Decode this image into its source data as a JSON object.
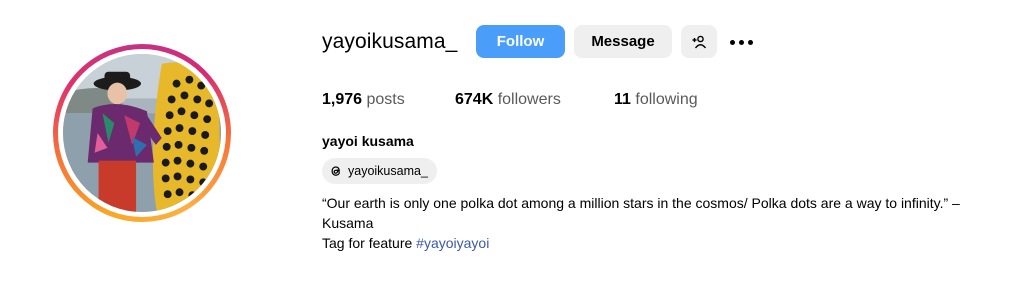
{
  "profile": {
    "username": "yayoikusama_",
    "full_name": "yayoi kusama",
    "threads_handle": "yayoikusama_",
    "avatar_alt": "yayoikusama_'s profile picture"
  },
  "actions": {
    "follow_label": "Follow",
    "message_label": "Message",
    "suggest_icon": "person-add-icon",
    "more_icon": "more-options-icon"
  },
  "stats": {
    "posts_count": "1,976",
    "posts_label": "posts",
    "followers_count": "674K",
    "followers_label": "followers",
    "following_count": "11",
    "following_label": "following"
  },
  "bio": {
    "quote_line": "“Our earth is only one polka dot among a million stars in the cosmos/ Polka dots are a way to infinity.” – Kusama",
    "tag_prefix": "Tag for feature ",
    "hashtag": "#yayoiyayoi"
  },
  "colors": {
    "follow_button": "#4a9df8",
    "secondary_button": "#efefef",
    "hashtag": "#3a5aa8",
    "story_ring": [
      "#f9a825",
      "#e1306c",
      "#c13584"
    ]
  }
}
